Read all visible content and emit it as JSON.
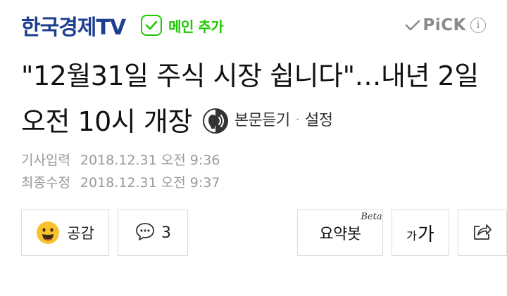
{
  "header": {
    "press_name": "한국경제TV",
    "main_add_label": "메인 추가",
    "pick_label": "PiCK",
    "info_glyph": "i"
  },
  "article": {
    "headline": "\"12월31일 주식 시장 쉽니다\"…내년 2일 오전 10시 개장",
    "tts_label": "본문듣기",
    "tts_separator": "·",
    "tts_settings_label": "설정",
    "published_label": "기사입력",
    "published_value": "2018.12.31 오전 9:36",
    "modified_label": "최종수정",
    "modified_value": "2018.12.31 오전 9:37"
  },
  "actions": {
    "empathy_label": "공감",
    "comment_count": "3",
    "summary_label": "요약봇",
    "summary_badge": "Beta",
    "font_small": "가",
    "font_large": "가"
  },
  "colors": {
    "press_blue": "#1e3f8f",
    "naver_green": "#1ec800",
    "muted_gray": "#9a9a9a",
    "emoji_yellow": "#f9c22d"
  },
  "icons": {
    "main_add": "check-box-icon",
    "pick": "checkmark-icon",
    "info": "info-circle-icon",
    "tts": "tts-face-icon",
    "empathy": "smiley-face-icon",
    "comment": "speech-bubble-icon",
    "share": "share-icon"
  }
}
